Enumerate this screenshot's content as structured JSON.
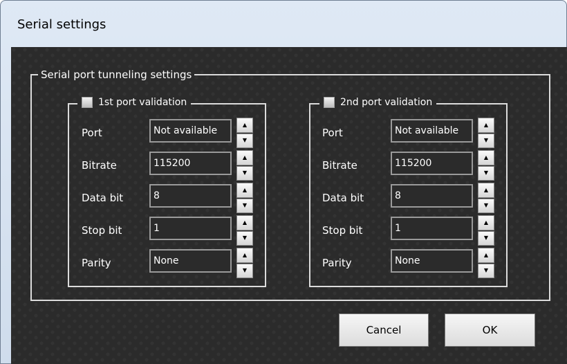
{
  "window": {
    "title": "Serial settings"
  },
  "group": {
    "legend": "Serial port tunneling settings"
  },
  "ports": [
    {
      "legend": "1st port validation",
      "checked": false,
      "fields": [
        {
          "label": "Port",
          "value": "Not available"
        },
        {
          "label": "Bitrate",
          "value": "115200"
        },
        {
          "label": "Data bit",
          "value": "8"
        },
        {
          "label": "Stop bit",
          "value": "1"
        },
        {
          "label": "Parity",
          "value": "None"
        }
      ]
    },
    {
      "legend": "2nd port validation",
      "checked": false,
      "fields": [
        {
          "label": "Port",
          "value": "Not available"
        },
        {
          "label": "Bitrate",
          "value": "115200"
        },
        {
          "label": "Data bit",
          "value": "8"
        },
        {
          "label": "Stop bit",
          "value": "1"
        },
        {
          "label": "Parity",
          "value": "None"
        }
      ]
    }
  ],
  "buttons": {
    "cancel": "Cancel",
    "ok": "OK"
  },
  "icons": {
    "spin_up": "triangle-up",
    "spin_down": "triangle-down"
  }
}
